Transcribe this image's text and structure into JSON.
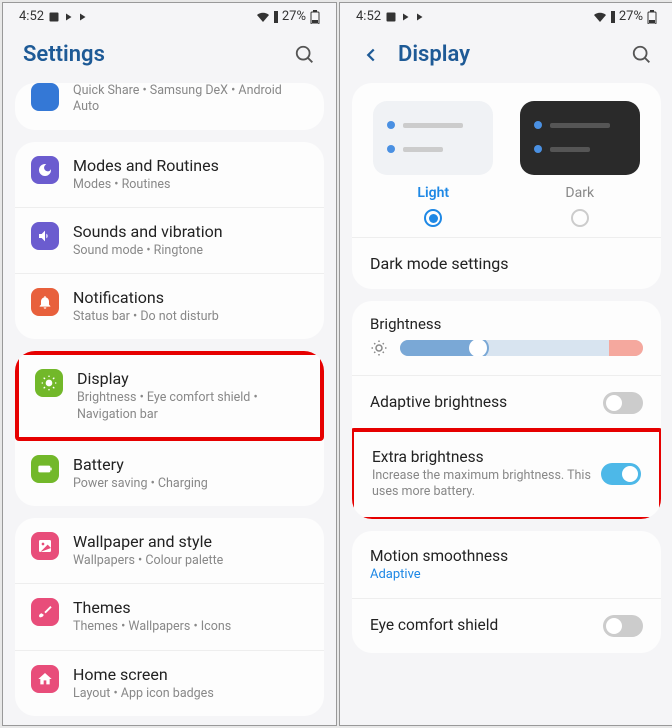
{
  "status": {
    "time": "4:52",
    "battery": "27%"
  },
  "left": {
    "title": "Settings",
    "truncated": {
      "sub": "Quick Share  •  Samsung DeX  •  Android Auto"
    },
    "group1": [
      {
        "title": "Modes and Routines",
        "sub": "Modes  •  Routines",
        "color": "#6b5ccf",
        "icon": "moon"
      },
      {
        "title": "Sounds and vibration",
        "sub": "Sound mode  •  Ringtone",
        "color": "#6b5ccf",
        "icon": "sound"
      },
      {
        "title": "Notifications",
        "sub": "Status bar  •  Do not disturb",
        "color": "#e8603c",
        "icon": "bell"
      }
    ],
    "group2": [
      {
        "title": "Display",
        "sub": "Brightness  •  Eye comfort shield  •  Navigation bar",
        "color": "#72b82a",
        "icon": "sun",
        "highlight": true
      },
      {
        "title": "Battery",
        "sub": "Power saving  •  Charging",
        "color": "#72b82a",
        "icon": "battery"
      }
    ],
    "group3": [
      {
        "title": "Wallpaper and style",
        "sub": "Wallpapers  •  Colour palette",
        "color": "#e84d7a",
        "icon": "image"
      },
      {
        "title": "Themes",
        "sub": "Themes  •  Wallpapers  •  Icons",
        "color": "#e84d7a",
        "icon": "brush"
      },
      {
        "title": "Home screen",
        "sub": "Layout  •  App icon badges",
        "color": "#e84d7a",
        "icon": "home"
      }
    ]
  },
  "right": {
    "title": "Display",
    "theme": {
      "light": "Light",
      "dark": "Dark"
    },
    "darkModeSettings": "Dark mode settings",
    "brightness": "Brightness",
    "adaptive": "Adaptive brightness",
    "extra": {
      "title": "Extra brightness",
      "sub": "Increase the maximum brightness. This uses more battery."
    },
    "motion": {
      "title": "Motion smoothness",
      "value": "Adaptive"
    },
    "eye": "Eye comfort shield"
  }
}
